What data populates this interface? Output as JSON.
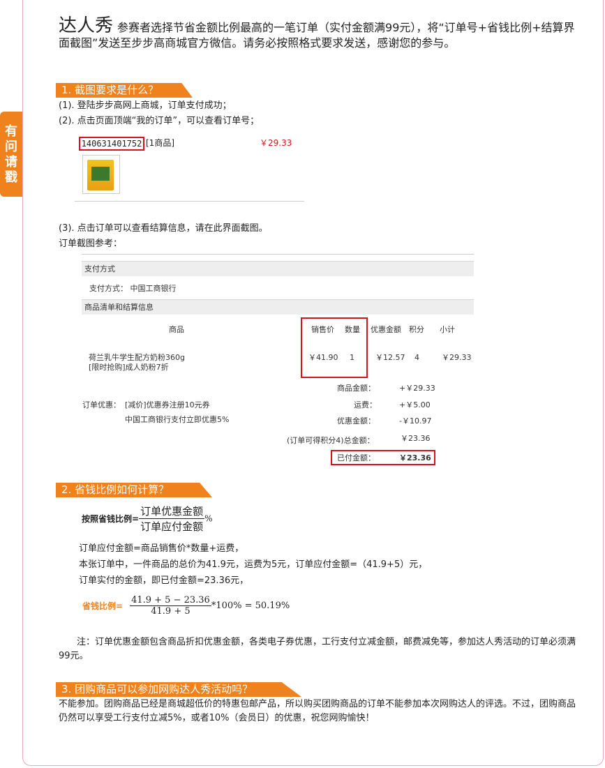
{
  "sidetab": [
    "有",
    "问",
    "请",
    "戳"
  ],
  "intro": {
    "big": "达人秀",
    "text": "参赛者选择节省金额比例最高的一笔订单（实付金额满99元），将“订单号+省钱比例+结算界面截图”发送至步步高商城官方微信。请务必按照格式要求发送，感谢您的参与。"
  },
  "sections": {
    "s1": "1.  截图要求是什么？",
    "s2": "2.  省钱比例如何计算？",
    "s3": "3.  团购商品可以参加网购达人秀活动吗？"
  },
  "step1": "(1).  登陆步步高网上商城，订单支付成功；",
  "step2": "(2).  点击页面顶端“我的订单”，可以查看订单号；",
  "order": {
    "id": "140631401752",
    "count": "[1商品]",
    "amount": "￥29.33"
  },
  "step3": "(3).  点击订单可以查看结算信息，请在此界面截图。",
  "ref_label": "订单截图参考：",
  "screenshot": {
    "pay_section": "支付方式",
    "pay_label": "支付方式：  中国工商银行",
    "goods_section": "商品清单和结算信息",
    "headers": {
      "product": "商品",
      "price": "销售价",
      "qty": "数量",
      "discount": "优惠金额",
      "points": "积分",
      "subtotal": "小计"
    },
    "row": {
      "name1": "荷兰乳牛学生配方奶粉360g",
      "name2": "[限时抢购]成人奶粉7折",
      "price": "￥41.90",
      "qty": "1",
      "discount": "￥12.57",
      "points": "4",
      "subtotal": "￥29.33"
    },
    "promo_label": "订单优惠：",
    "promo1": "[减价]优惠券注册10元券",
    "promo2": "中国工商银行支付立即优惠5%",
    "sum_labels": [
      "商品金额：",
      "运费：",
      "优惠金额：",
      "(订单可得积分4)总金额：",
      "已付金额："
    ],
    "sum_values": [
      "+￥29.33",
      "+￥5.00",
      "-￥10.97",
      "￥23.36",
      "￥23.36"
    ]
  },
  "formula1": {
    "label": "按照省钱比例=",
    "num": "订单优惠金额",
    "den": "订单应付金额",
    "suffix": "%"
  },
  "calc_lines": [
    "订单应付金额=商品销售价*数量+运费，",
    "本张订单中，一件商品的总价为41.9元，运费为5元，订单应付金额=（41.9+5）元，",
    "订单实付的金额，即已付金额=23.36元，"
  ],
  "formula2": {
    "label": "省钱比例=",
    "num": "41.9 + 5 − 23.36",
    "den": "41.9 + 5",
    "suffix": "*100% = 50.19%"
  },
  "note": "注：订单优惠金额包含商品折扣优惠金额，各类电子券优惠，工行支付立减金额，邮费减免等，参加达人秀活动的订单必须满99元。",
  "s3_text": "不能参加。团购商品已经是商城超低价的特惠包邮产品，所以购买团购商品的订单不能参加本次网购达人的评选。不过，团购商品仍然可以享受工行支付立减5%，或者10%（会员日）的优惠，祝您网购愉快！",
  "colors": {
    "accent": "#f0821e",
    "red": "#d8121a",
    "border": "#e8a8b8"
  }
}
